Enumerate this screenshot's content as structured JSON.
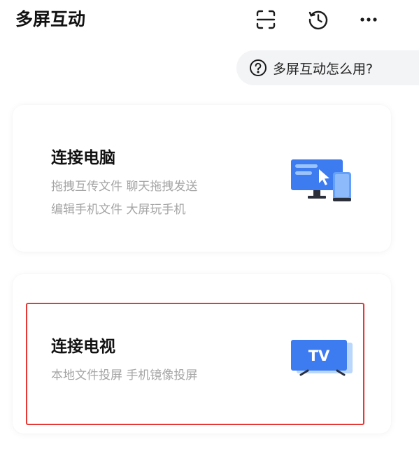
{
  "header": {
    "title": "多屏互动",
    "icons": [
      "scan-icon",
      "history-icon",
      "more-icon"
    ]
  },
  "help": {
    "label": "多屏互动怎么用?",
    "icon": "question-circle-icon"
  },
  "cards": [
    {
      "title": "连接电脑",
      "desc_lines": [
        "拖拽互传文件 聊天拖拽发送",
        "编辑手机文件 大屏玩手机"
      ],
      "icon": "computer-phone-icon"
    },
    {
      "title": "连接电视",
      "desc_lines": [
        "本地文件投屏 手机镜像投屏"
      ],
      "icon": "tv-icon",
      "icon_text": "TV"
    }
  ],
  "colors": {
    "accent_blue": "#3d7bf0",
    "light_blue": "#9cc4fb",
    "highlight_red": "#e53935",
    "secondary_text": "#a5a5a5"
  }
}
